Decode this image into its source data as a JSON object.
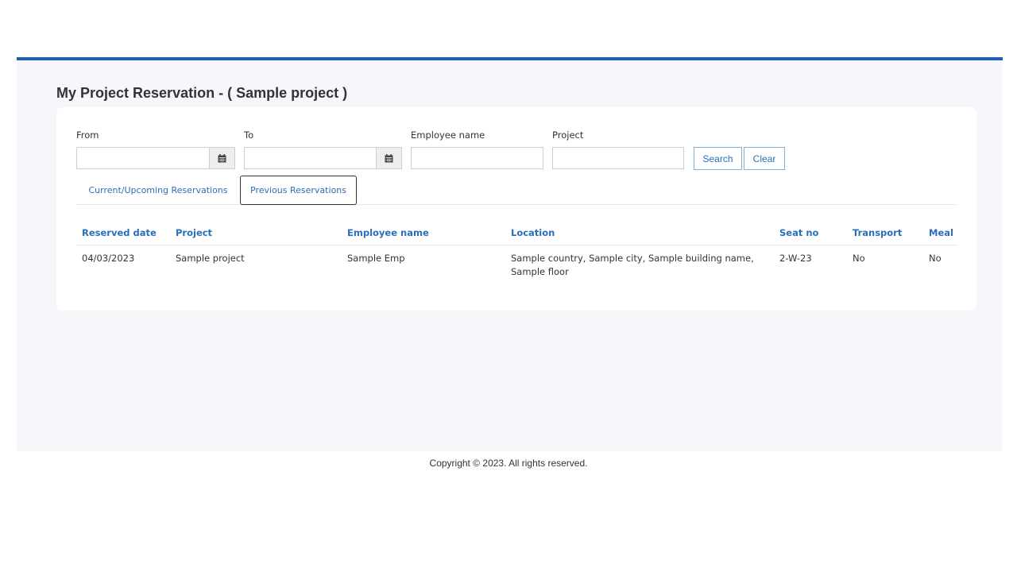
{
  "page": {
    "title": "My Project Reservation - ( Sample project )"
  },
  "filters": {
    "from_label": "From",
    "from_value": "",
    "to_label": "To",
    "to_value": "",
    "employee_label": "Employee name",
    "employee_value": "",
    "project_label": "Project",
    "project_value": "",
    "search_label": "Search",
    "clear_label": "Clear"
  },
  "tabs": [
    {
      "label": "Current/Upcoming Reservations",
      "active": false
    },
    {
      "label": "Previous Reservations",
      "active": true
    }
  ],
  "table": {
    "columns": [
      "Reserved date",
      "Project",
      "Employee name",
      "Location",
      "Seat no",
      "Transport",
      "Meal"
    ],
    "rows": [
      {
        "reserved_date": "04/03/2023",
        "project": "Sample project",
        "employee_name": "Sample Emp",
        "location": "Sample country, Sample city, Sample building name, Sample floor",
        "seat_no": "2-W-23",
        "transport": "No",
        "meal": "No"
      }
    ]
  },
  "footer": {
    "copyright": "Copyright © 2023. All rights reserved."
  },
  "colors": {
    "header_bar": "#1f5fad",
    "link_blue": "#2a6ebb",
    "page_background": "#f5f7fb"
  },
  "icons": {
    "date_picker": "calendar-icon"
  }
}
